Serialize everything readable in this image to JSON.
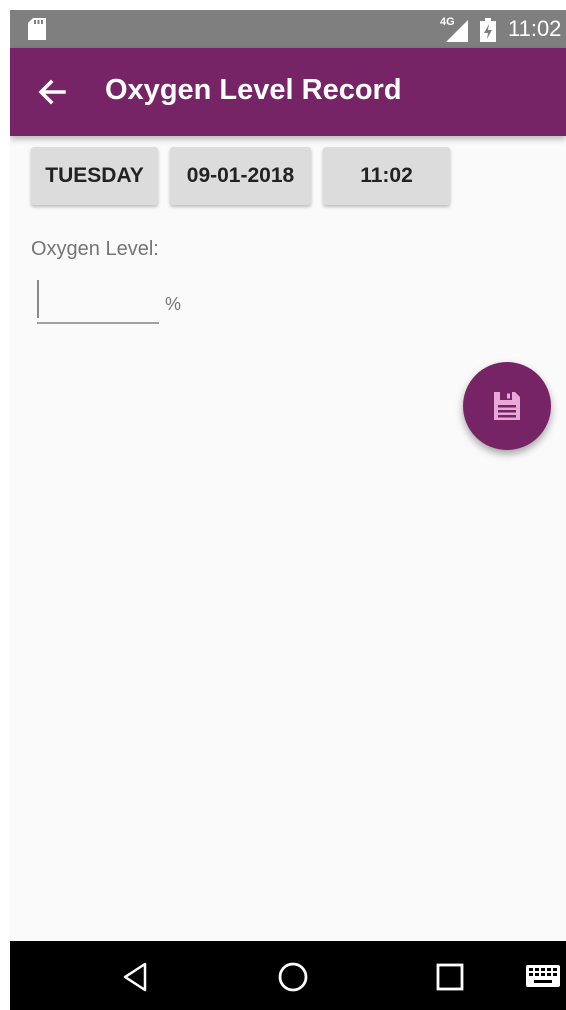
{
  "status_bar": {
    "network": "4G",
    "time": "11:02"
  },
  "app_bar": {
    "title": "Oxygen Level Record",
    "back_icon": "arrow-left-icon"
  },
  "chips": {
    "day": "TUESDAY",
    "date": "09-01-2018",
    "time": "11:02"
  },
  "form": {
    "label": "Oxygen Level:",
    "value": "",
    "unit": "%"
  },
  "fab": {
    "icon": "save-icon"
  },
  "colors": {
    "primary": "#762466",
    "status_bar": "#7f7f7f",
    "chip": "#dcdcdc",
    "background": "#fafafa"
  }
}
